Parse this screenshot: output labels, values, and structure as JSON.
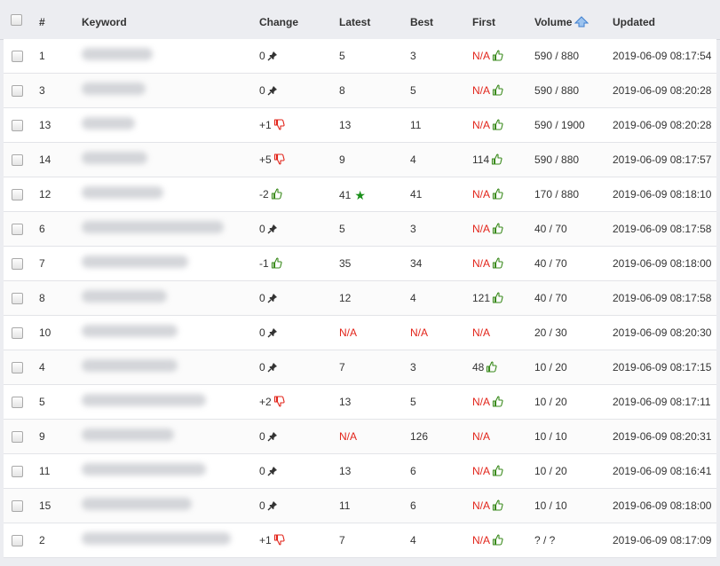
{
  "header": {
    "num": "#",
    "keyword": "Keyword",
    "change": "Change",
    "latest": "Latest",
    "best": "Best",
    "first": "First",
    "volume": "Volume",
    "updated": "Updated"
  },
  "rows": [
    {
      "num": "1",
      "change": "0",
      "change_icon": "pin-icon",
      "latest": "5",
      "best": "3",
      "first": "N/A",
      "first_icon": "thumbs-up-icon",
      "volume": "590 / 880",
      "updated": "2019-06-09 08:17:54"
    },
    {
      "num": "3",
      "change": "0",
      "change_icon": "pin-icon",
      "latest": "8",
      "best": "5",
      "first": "N/A",
      "first_icon": "thumbs-up-icon",
      "volume": "590 / 880",
      "updated": "2019-06-09 08:20:28"
    },
    {
      "num": "13",
      "change": "+1",
      "change_icon": "thumbs-down-icon",
      "latest": "13",
      "best": "11",
      "first": "N/A",
      "first_icon": "thumbs-up-icon",
      "volume": "590 / 1900",
      "updated": "2019-06-09 08:20:28"
    },
    {
      "num": "14",
      "change": "+5",
      "change_icon": "thumbs-down-icon",
      "latest": "9",
      "best": "4",
      "first": "114",
      "first_icon": "thumbs-up-icon",
      "volume": "590 / 880",
      "updated": "2019-06-09 08:17:57"
    },
    {
      "num": "12",
      "change": "-2",
      "change_icon": "thumbs-up-icon",
      "latest": "41",
      "latest_star": true,
      "best": "41",
      "first": "N/A",
      "first_icon": "thumbs-up-icon",
      "volume": "170 / 880",
      "updated": "2019-06-09 08:18:10"
    },
    {
      "num": "6",
      "change": "0",
      "change_icon": "pin-icon",
      "latest": "5",
      "best": "3",
      "first": "N/A",
      "first_icon": "thumbs-up-icon",
      "volume": "40 / 70",
      "updated": "2019-06-09 08:17:58"
    },
    {
      "num": "7",
      "change": "-1",
      "change_icon": "thumbs-up-icon",
      "latest": "35",
      "best": "34",
      "first": "N/A",
      "first_icon": "thumbs-up-icon",
      "volume": "40 / 70",
      "updated": "2019-06-09 08:18:00"
    },
    {
      "num": "8",
      "change": "0",
      "change_icon": "pin-icon",
      "latest": "12",
      "best": "4",
      "first": "121",
      "first_icon": "thumbs-up-icon",
      "volume": "40 / 70",
      "updated": "2019-06-09 08:17:58"
    },
    {
      "num": "10",
      "change": "0",
      "change_icon": "pin-icon",
      "latest": "N/A",
      "best": "N/A",
      "first": "N/A",
      "first_icon": "",
      "volume": "20 / 30",
      "updated": "2019-06-09 08:20:30"
    },
    {
      "num": "4",
      "change": "0",
      "change_icon": "pin-icon",
      "latest": "7",
      "best": "3",
      "first": "48",
      "first_icon": "thumbs-up-icon",
      "volume": "10 / 20",
      "updated": "2019-06-09 08:17:15"
    },
    {
      "num": "5",
      "change": "+2",
      "change_icon": "thumbs-down-icon",
      "latest": "13",
      "best": "5",
      "first": "N/A",
      "first_icon": "thumbs-up-icon",
      "volume": "10 / 20",
      "updated": "2019-06-09 08:17:11"
    },
    {
      "num": "9",
      "change": "0",
      "change_icon": "pin-icon",
      "latest": "N/A",
      "best": "126",
      "first": "N/A",
      "first_icon": "",
      "volume": "10 / 10",
      "updated": "2019-06-09 08:20:31"
    },
    {
      "num": "11",
      "change": "0",
      "change_icon": "pin-icon",
      "latest": "13",
      "best": "6",
      "first": "N/A",
      "first_icon": "thumbs-up-icon",
      "volume": "10 / 20",
      "updated": "2019-06-09 08:16:41"
    },
    {
      "num": "15",
      "change": "0",
      "change_icon": "pin-icon",
      "latest": "11",
      "best": "6",
      "first": "N/A",
      "first_icon": "thumbs-up-icon",
      "volume": "10 / 10",
      "updated": "2019-06-09 08:18:00"
    },
    {
      "num": "2",
      "change": "+1",
      "change_icon": "thumbs-down-icon",
      "latest": "7",
      "best": "4",
      "first": "N/A",
      "first_icon": "thumbs-up-icon",
      "volume": "? / ?",
      "updated": "2019-06-09 08:17:09"
    }
  ],
  "colors": {
    "na": "#e2241a",
    "thumbs_up": "#3a8a1c",
    "thumbs_down": "#e2241a",
    "star": "#1a8f1a",
    "sort_arrow": "#4a90d9"
  }
}
